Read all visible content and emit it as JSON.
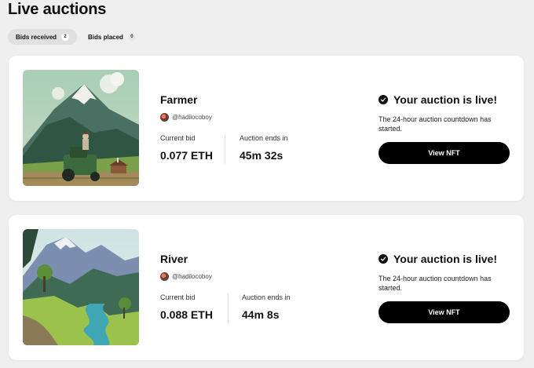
{
  "page": {
    "title": "Live auctions"
  },
  "tabs": [
    {
      "label": "Bids received",
      "count": "2",
      "active": true
    },
    {
      "label": "Bids placed",
      "count": "0",
      "active": false
    }
  ],
  "auctions": [
    {
      "name": "Farmer",
      "owner": "@hadilocoboy",
      "current_bid_label": "Current bid",
      "current_bid": "0.077 ETH",
      "ends_label": "Auction ends in",
      "ends_in": "45m 32s",
      "live_title": "Your auction is live!",
      "live_desc": "The 24-hour auction countdown has started.",
      "button_label": "View NFT"
    },
    {
      "name": "River",
      "owner": "@hadilocoboy",
      "current_bid_label": "Current bid",
      "current_bid": "0.088 ETH",
      "ends_label": "Auction ends in",
      "ends_in": "44m 8s",
      "live_title": "Your auction is live!",
      "live_desc": "The 24-hour auction countdown has started.",
      "button_label": "View NFT"
    }
  ],
  "icons": {
    "check": "check-circle-icon",
    "avatar": "avatar"
  },
  "colors": {
    "button": "#000000",
    "active_tab": "#e0e0e0",
    "page_bg": "#efefef"
  }
}
